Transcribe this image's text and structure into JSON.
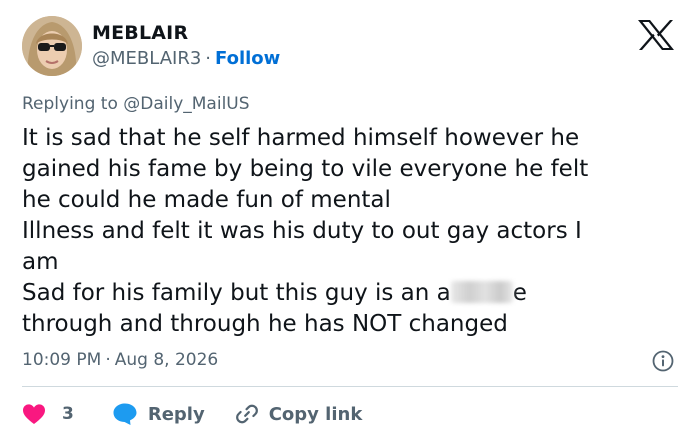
{
  "user": {
    "display_name": "MEBLAIR",
    "handle": "@MEBLAIR3",
    "separator": "·",
    "follow_label": "Follow"
  },
  "reply_context": {
    "prefix": "Replying to",
    "mention": "@Daily_MailUS"
  },
  "tweet": {
    "text_before_blur": "It is sad that he self harmed himself however he\ngained his fame by being to vile everyone  he felt\nhe could he made fun of mental\nIllness and felt it was his duty to out gay actors I\nam\nSad for his family but this guy is an a",
    "text_after_blur": "e\nthrough and through he has NOT changed"
  },
  "meta": {
    "time": "10:09 PM",
    "separator": "·",
    "date": "Aug 8, 2026"
  },
  "actions": {
    "like_count": "3",
    "reply_label": "Reply",
    "copy_link_label": "Copy link"
  },
  "colors": {
    "like": "#f91880",
    "reply": "#1d9bf0",
    "link": "#006fd6",
    "muted": "#536471"
  },
  "icons": [
    "x-logo-icon",
    "info-icon",
    "heart-icon",
    "reply-bubble-icon",
    "link-icon"
  ]
}
